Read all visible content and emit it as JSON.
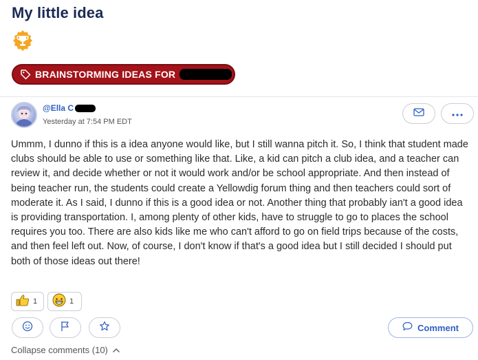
{
  "post": {
    "title": "My little idea",
    "category_label": "BRAINSTORMING IDEAS FOR",
    "author": "@Ella C",
    "timestamp": "Yesterday at 7:54 PM EDT",
    "body": "Ummm, I dunno if this is a idea anyone would like, but I still wanna pitch it. So, I think that student made clubs should be able to use or something like that. Like, a kid can pitch a club idea, and a teacher can review it, and decide whether or not it would work and/or be school appropriate. And then instead of being teacher run, the students could create a Yellowdig forum thing and then teachers could sort of moderate it. As I said, I dunno if this is a good idea or not. Another thing that probably ian't a good idea is providing transportation. I, among plenty of other kids, have to struggle to go to places the school requires you too. There are also kids like me who can't afford to go on field trips because of the costs, and then feel left out. Now, of course, I don't know if that's a good idea but I still decided I should put both of those ideas out there!"
  },
  "reactions": [
    {
      "icon": "thumbs-up-icon",
      "count": "1"
    },
    {
      "icon": "grinning-face-icon",
      "count": "1"
    }
  ],
  "actions": {
    "comment_label": "Comment",
    "collapse_label": "Collapse comments (10)"
  },
  "colors": {
    "title": "#1b2a52",
    "tag_bg": "#a3131a",
    "link_blue": "#2f5fc4",
    "trophy": "#f5a623"
  }
}
